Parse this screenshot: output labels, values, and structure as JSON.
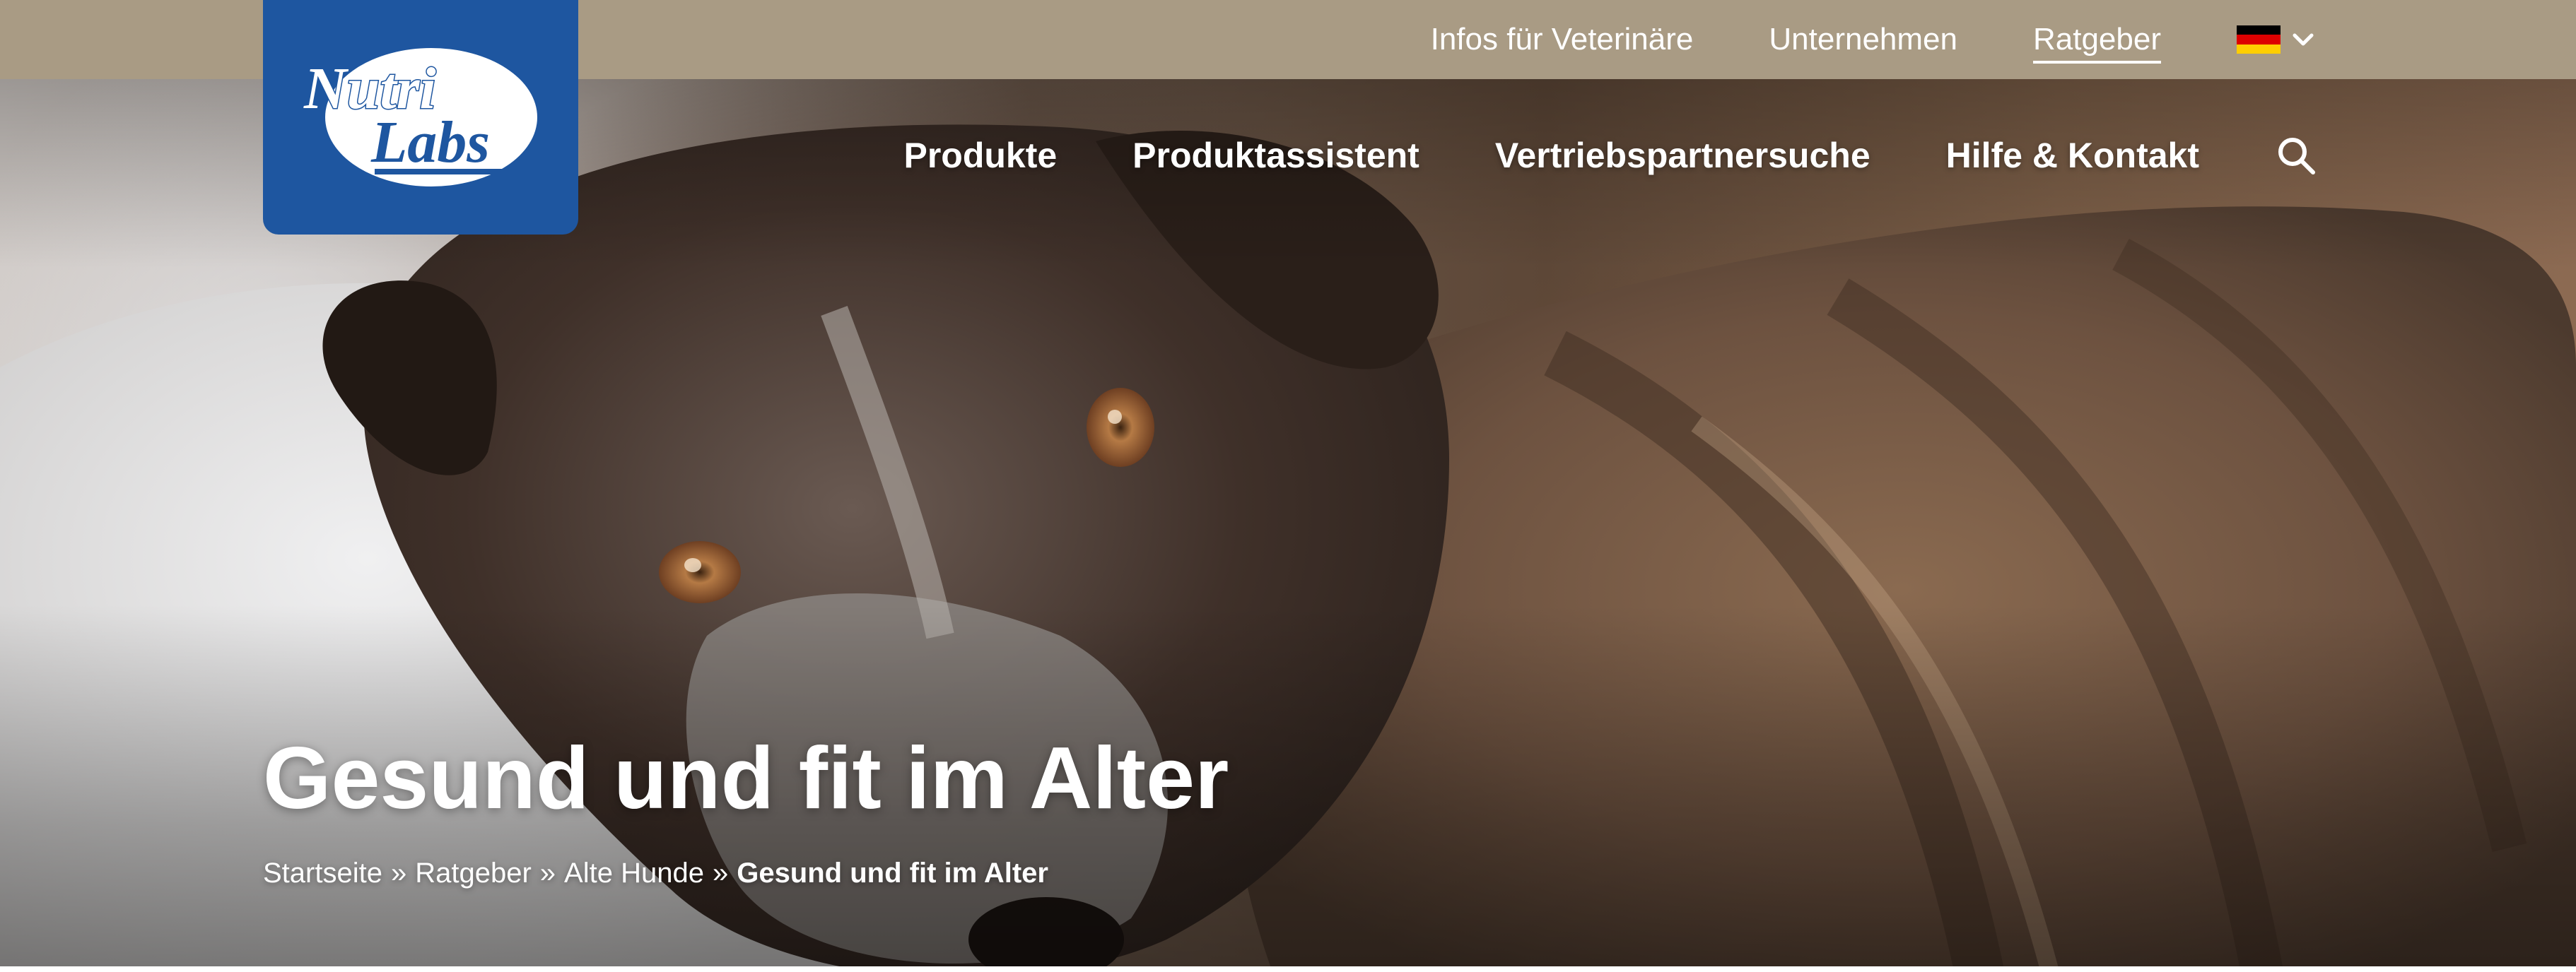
{
  "brand": {
    "logo_line1": "Nutri",
    "logo_line2": "Labs",
    "logo_color": "#1e56a0",
    "topbar_color": "#a99b84"
  },
  "topbar": {
    "links": [
      {
        "label": "Infos für Veterinäre",
        "active": false
      },
      {
        "label": "Unternehmen",
        "active": false
      },
      {
        "label": "Ratgeber",
        "active": true
      }
    ],
    "language": {
      "flag": "de-flag-icon",
      "chevron": "chevron-down-icon"
    }
  },
  "main_nav": {
    "items": [
      {
        "label": "Produkte"
      },
      {
        "label": "Produktassistent"
      },
      {
        "label": "Vertriebspartnersuche"
      },
      {
        "label": "Hilfe & Kontakt"
      }
    ],
    "search_icon": "search-icon"
  },
  "hero": {
    "title": "Gesund und fit im Alter",
    "image": "senior-dog-photo"
  },
  "breadcrumb": {
    "items": [
      "Startseite",
      "Ratgeber",
      "Alte Hunde"
    ],
    "current": "Gesund und fit im Alter",
    "separator": "»"
  }
}
